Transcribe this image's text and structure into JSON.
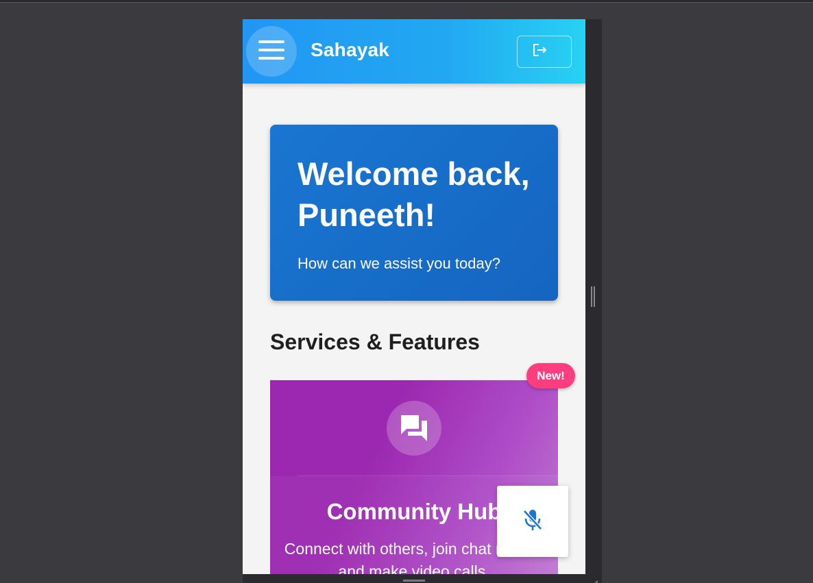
{
  "app": {
    "title": "Sahayak",
    "icons": {
      "menu": "menu-icon",
      "logout": "logout-icon",
      "microphone": "microphone-off-icon",
      "feature": "forum-icon"
    },
    "colors": {
      "app_bar_start": "#2196f3",
      "app_bar_end": "#27d2f3",
      "welcome_card": "#1976d2",
      "feature_card": "#9c27b0",
      "badge": "#ff3d7f",
      "mic_icon": "#1976d2"
    }
  },
  "welcome": {
    "title": "Welcome back, Puneeth!",
    "subtitle": "How can we assist you today?"
  },
  "services": {
    "heading": "Services & Features",
    "badge": "New!",
    "cards": [
      {
        "title": "Community Hub",
        "description": "Connect with others, join chat rooms, and make video calls."
      }
    ]
  }
}
